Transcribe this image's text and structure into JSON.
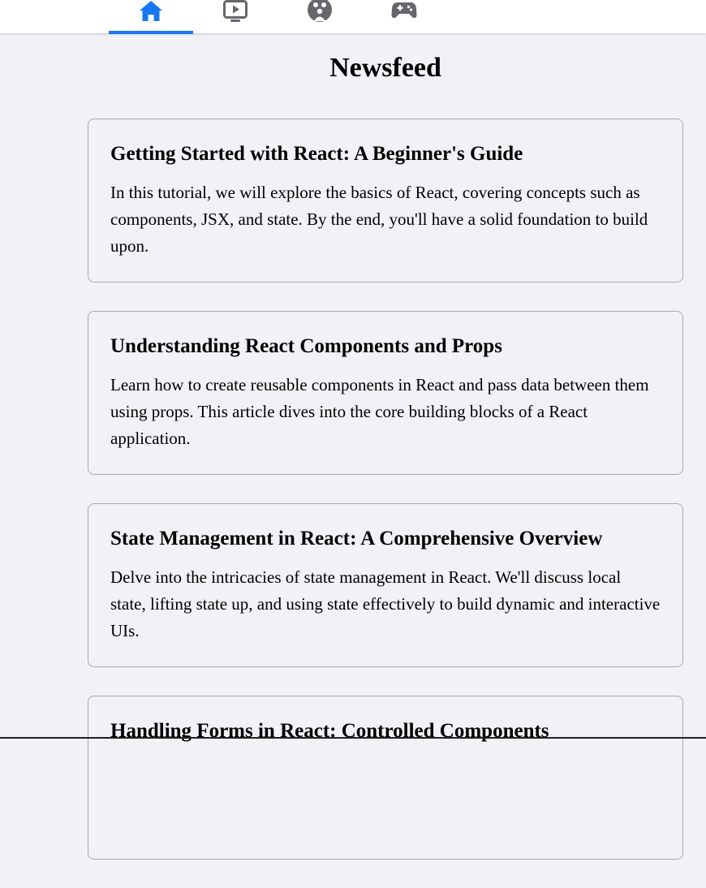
{
  "nav": {
    "tabs": [
      {
        "name": "home",
        "icon": "home-icon",
        "active": true
      },
      {
        "name": "watch",
        "icon": "video-icon",
        "active": false
      },
      {
        "name": "groups",
        "icon": "groups-icon",
        "active": false
      },
      {
        "name": "gaming",
        "icon": "gamepad-icon",
        "active": false
      }
    ],
    "active_color": "#1877f2",
    "inactive_color": "#65676b"
  },
  "page": {
    "title": "Newsfeed"
  },
  "posts": [
    {
      "title": "Getting Started with React: A Beginner's Guide",
      "excerpt": "In this tutorial, we will explore the basics of React, covering concepts such as components, JSX, and state. By the end, you'll have a solid foundation to build upon."
    },
    {
      "title": "Understanding React Components and Props",
      "excerpt": "Learn how to create reusable components in React and pass data between them using props. This article dives into the core building blocks of a React application."
    },
    {
      "title": "State Management in React: A Comprehensive Overview",
      "excerpt": "Delve into the intricacies of state management in React. We'll discuss local state, lifting state up, and using state effectively to build dynamic and interactive UIs."
    },
    {
      "title": "Handling Forms in React: Controlled Components",
      "excerpt": ""
    }
  ]
}
